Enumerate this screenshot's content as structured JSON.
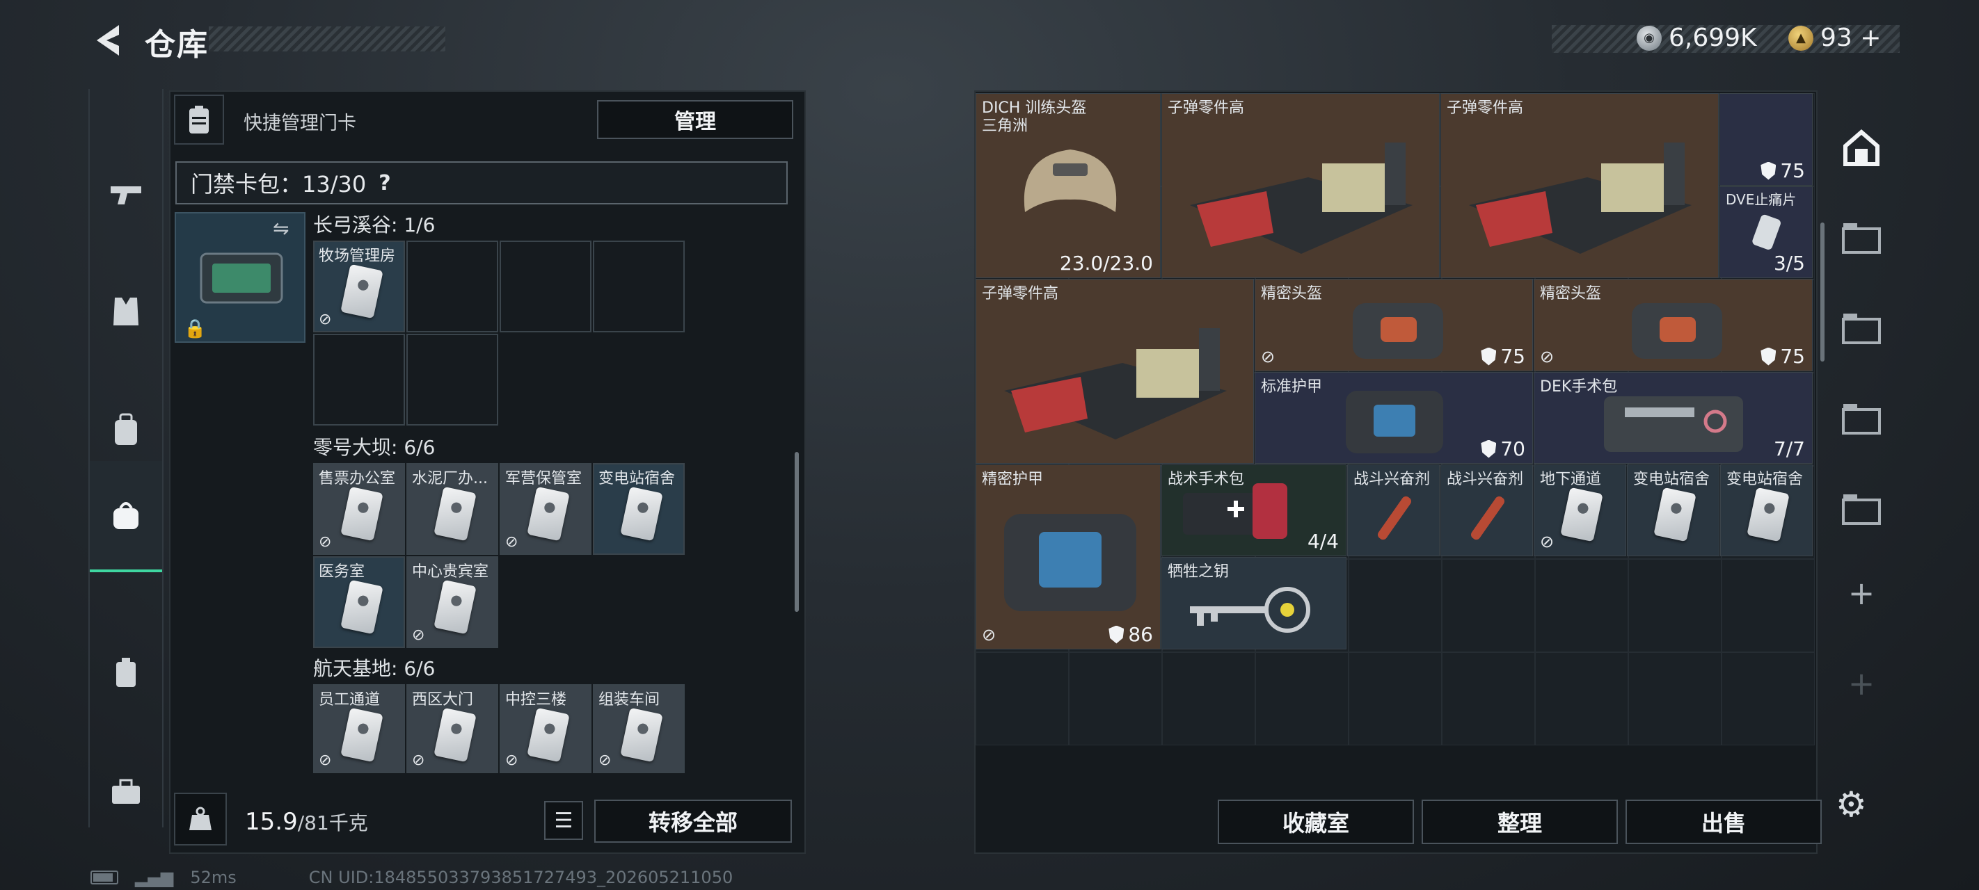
{
  "header": {
    "title": "仓库",
    "currency_silver": "6,699K",
    "currency_gold": "93 +"
  },
  "left": {
    "quick_label": "快捷管理门卡",
    "manage_label": "管理",
    "cardbox_label": "门禁卡包：13/30",
    "help_glyph": "?",
    "groups": [
      {
        "title": "长弓溪谷: 1/6",
        "cards": [
          "牧场管理房"
        ]
      },
      {
        "title": "零号大坝: 6/6",
        "cards": [
          "售票办公室",
          "水泥厂办...",
          "军营保管室",
          "变电站宿舍",
          "医务室",
          "中心贵宾室"
        ]
      },
      {
        "title": "航天基地: 6/6",
        "cards": [
          "员工通道",
          "西区大门",
          "中控三楼",
          "组装车间"
        ]
      }
    ],
    "weight_value": "15.9",
    "weight_max": "/81千克",
    "transfer_label": "转移全部"
  },
  "status": {
    "ping": "52ms",
    "uid": "CN UID:1848550337938517274​93_202605211050"
  },
  "storage": {
    "items": [
      {
        "label": "DICH 训练头盔",
        "sub": "三角洲",
        "value": "23.0/23.0"
      },
      {
        "label": "子弹零件高"
      },
      {
        "label": "子弹零件高"
      },
      {
        "value": "75"
      },
      {
        "label": "DVE止痛片",
        "value": "3/5"
      },
      {
        "label": "子弹零件高"
      },
      {
        "label": "精密头盔",
        "value": "75"
      },
      {
        "label": "精密头盔",
        "value": "75"
      },
      {
        "label": "标准护甲",
        "value": "70"
      },
      {
        "label": "DEK手术包",
        "value": "7/7"
      },
      {
        "label": "精密护甲",
        "value": "86"
      },
      {
        "label": "战术手术包",
        "value": "4/4"
      },
      {
        "label": "战斗兴奋剂"
      },
      {
        "label": "战斗兴奋剂"
      },
      {
        "label": "地下通道"
      },
      {
        "label": "变电站宿舍"
      },
      {
        "label": "变电站宿舍"
      },
      {
        "label": "牺牲之钥"
      }
    ],
    "buttons": [
      "收藏室",
      "整理",
      "出售"
    ]
  }
}
